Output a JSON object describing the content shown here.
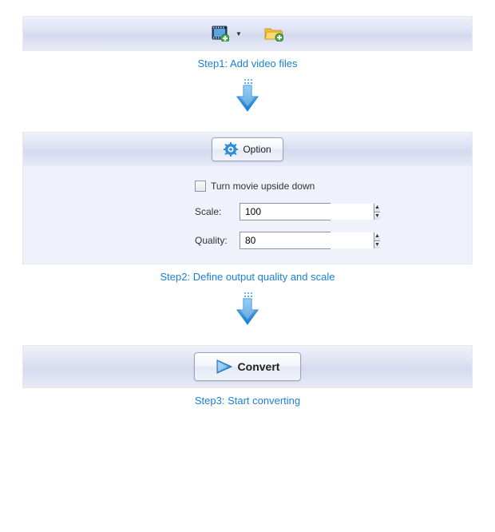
{
  "steps": {
    "step1": {
      "caption": "Step1: Add video files"
    },
    "step2": {
      "caption": "Step2: Define output quality and scale",
      "option_button": "Option",
      "flip_label": "Turn movie upside down",
      "scale_label": "Scale:",
      "scale_value": "100",
      "quality_label": "Quality:",
      "quality_value": "80"
    },
    "step3": {
      "caption": "Step3: Start converting",
      "convert_button": "Convert"
    }
  },
  "icons": {
    "add_video": "add-video-icon",
    "add_folder": "add-folder-icon",
    "gear": "gear-icon",
    "play": "play-icon"
  },
  "colors": {
    "link": "#1b7fd6",
    "panel_bg": "#eff1fb",
    "arrow": "#3a9ee8"
  }
}
